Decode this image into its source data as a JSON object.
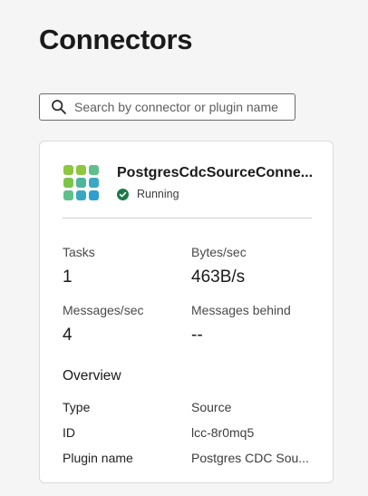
{
  "page": {
    "title": "Connectors"
  },
  "search": {
    "placeholder": "Search by connector or plugin name",
    "value": ""
  },
  "connector": {
    "name": "PostgresCdcSourceConne...",
    "status": "Running",
    "status_color": "#1e7a4a",
    "logo_icon": "grid-tile-logo-icon",
    "metrics": {
      "tasks_label": "Tasks",
      "tasks_value": "1",
      "bytes_label": "Bytes/sec",
      "bytes_value": "463B/s",
      "messages_label": "Messages/sec",
      "messages_value": "4",
      "behind_label": "Messages behind",
      "behind_value": "--"
    },
    "overview": {
      "title": "Overview",
      "rows": [
        {
          "key": "Type",
          "value": "Source"
        },
        {
          "key": "ID",
          "value": "lcc-8r0mq5"
        },
        {
          "key": "Plugin name",
          "value": "Postgres CDC Sou..."
        }
      ]
    }
  },
  "colors": {
    "accent_green": "#1e7a4a",
    "border": "#dadada",
    "background": "#f5f5f5"
  }
}
